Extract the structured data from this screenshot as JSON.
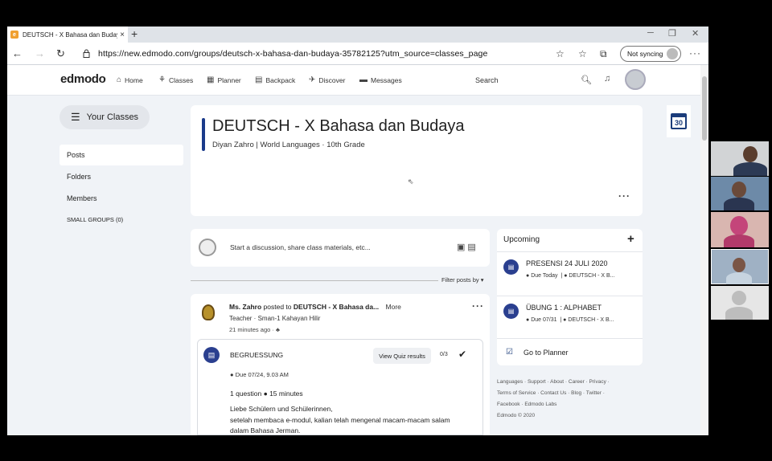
{
  "browser": {
    "tab_title": "DEUTSCH - X Bahasa dan Budaya",
    "tab_close": "×",
    "new_tab": "+",
    "url": "https://new.edmodo.com/groups/deutsch-x-bahasa-dan-budaya-35782125?utm_source=classes_page",
    "sync_label": "Not syncing",
    "menu": "···"
  },
  "header": {
    "logo": "edmodo",
    "nav": [
      {
        "label": "Home",
        "icon": "home-icon"
      },
      {
        "label": "Classes",
        "icon": "classes-icon"
      },
      {
        "label": "Planner",
        "icon": "planner-icon"
      },
      {
        "label": "Backpack",
        "icon": "backpack-icon"
      },
      {
        "label": "Discover",
        "icon": "discover-icon"
      },
      {
        "label": "Messages",
        "icon": "messages-icon"
      }
    ],
    "search_placeholder": "Search"
  },
  "sidebar": {
    "your_classes": "Your Classes",
    "items": [
      {
        "label": "Posts",
        "active": true
      },
      {
        "label": "Folders",
        "active": false
      },
      {
        "label": "Members",
        "active": false
      },
      {
        "label": "SMALL GROUPS (0)",
        "active": false
      }
    ]
  },
  "class_info": {
    "title": "DEUTSCH - X Bahasa dan Budaya",
    "subtitle": "Diyan Zahro | World Languages · 10th Grade",
    "more": "···"
  },
  "calendar": {
    "day": "30"
  },
  "composer": {
    "placeholder": "Start a discussion, share class materials, etc..."
  },
  "filter": {
    "label": "Filter posts by ▾"
  },
  "post": {
    "author": "Ms. Zahro",
    "posted_to": "posted to",
    "group": "DEUTSCH - X Bahasa da...",
    "more": "More",
    "role": "Teacher · Sman-1 Kahayan Hilir",
    "time": "21 minutes ago ·",
    "quiz": {
      "title": "BEGRUESSUNG",
      "view_button": "View Quiz results",
      "score": "0/3",
      "due": "Due 07/24, 9.03 AM",
      "meta": "1 question ● 15 minutes",
      "description": [
        "Liebe Schülern und Schülerinnen,",
        "setelah membaca e-modul, kalian telah mengenal macam-macam salam",
        "dalam Bahasa Jerman."
      ]
    }
  },
  "upcoming": {
    "title": "Upcoming",
    "add": "+",
    "items": [
      {
        "title": "PRESENSI 24 JULI 2020",
        "due": "Due Today",
        "group": "DEUTSCH - X B..."
      },
      {
        "title": "ÜBUNG 1 : ALPHABET",
        "due": "Due 07/31",
        "group": "DEUTSCH - X B..."
      }
    ],
    "planner_link": "Go to Planner"
  },
  "footer": {
    "lines": [
      "Languages · Support · About · Career · Privacy ·",
      "Terms of Service · Contact Us · Blog · Twitter ·",
      "Facebook · Edmodo Labs",
      "Edmodo © 2020"
    ]
  }
}
